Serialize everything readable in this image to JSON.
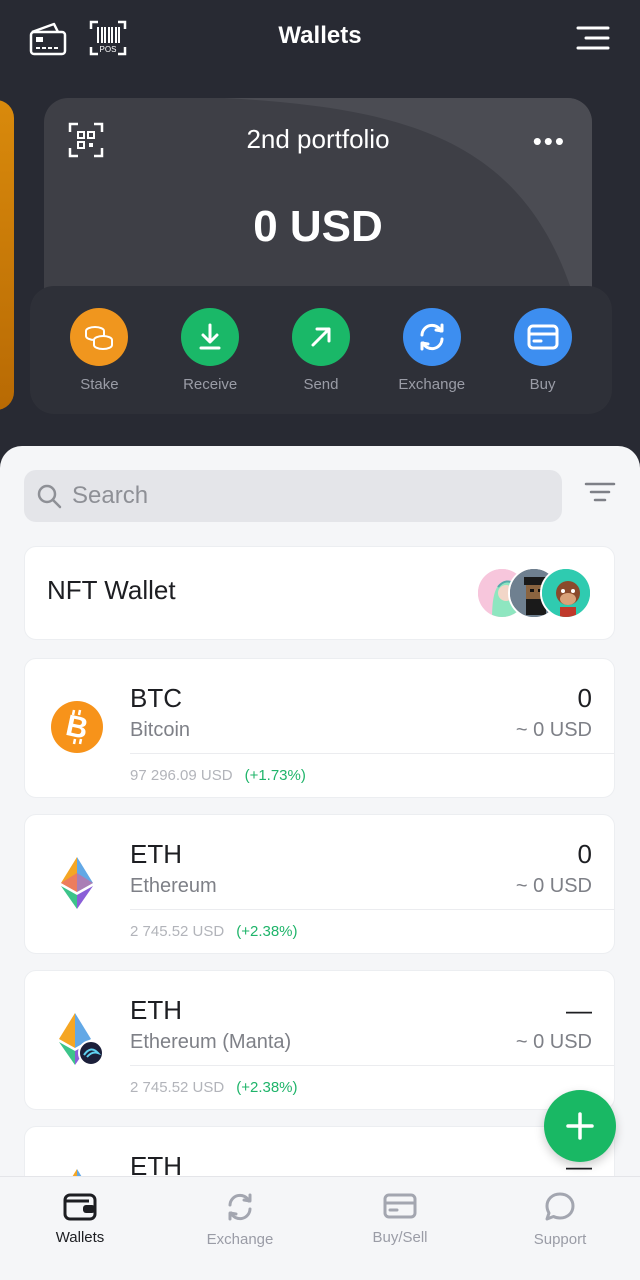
{
  "header": {
    "title": "Wallets",
    "pos_label": "POS"
  },
  "portfolio": {
    "name": "2nd portfolio",
    "more": "•••",
    "balance": "0 USD"
  },
  "actions": [
    {
      "label": "Stake",
      "color": "#f0961e",
      "icon": "coins-icon"
    },
    {
      "label": "Receive",
      "color": "#1ab868",
      "icon": "download-icon"
    },
    {
      "label": "Send",
      "color": "#1ab868",
      "icon": "arrow-up-right-icon"
    },
    {
      "label": "Exchange",
      "color": "#3d8ef0",
      "icon": "swap-icon"
    },
    {
      "label": "Buy",
      "color": "#3d8ef0",
      "icon": "card-icon"
    }
  ],
  "search": {
    "placeholder": "Search"
  },
  "nft": {
    "label": "NFT Wallet"
  },
  "coins": [
    {
      "ticker": "BTC",
      "name": "Bitcoin",
      "amount": "0",
      "usd": "~ 0 USD",
      "price": "97 296.09 USD",
      "change": "(+1.73%)"
    },
    {
      "ticker": "ETH",
      "name": "Ethereum",
      "amount": "0",
      "usd": "~ 0 USD",
      "price": "2 745.52 USD",
      "change": "(+2.38%)"
    },
    {
      "ticker": "ETH",
      "name": "Ethereum (Manta)",
      "amount": "—",
      "usd": "~ 0 USD",
      "price": "2 745.52 USD",
      "change": "(+2.38%)"
    },
    {
      "ticker": "ETH",
      "amount": "—"
    }
  ],
  "tabs": [
    {
      "label": "Wallets",
      "icon": "wallet-icon",
      "active": true
    },
    {
      "label": "Exchange",
      "icon": "swap-icon",
      "active": false
    },
    {
      "label": "Buy/Sell",
      "icon": "card-icon",
      "active": false
    },
    {
      "label": "Support",
      "icon": "chat-icon",
      "active": false
    }
  ],
  "colors": {
    "background": "#282a33",
    "positive": "#1fb46a",
    "accent_green": "#19b864",
    "bitcoin": "#f7931a"
  }
}
